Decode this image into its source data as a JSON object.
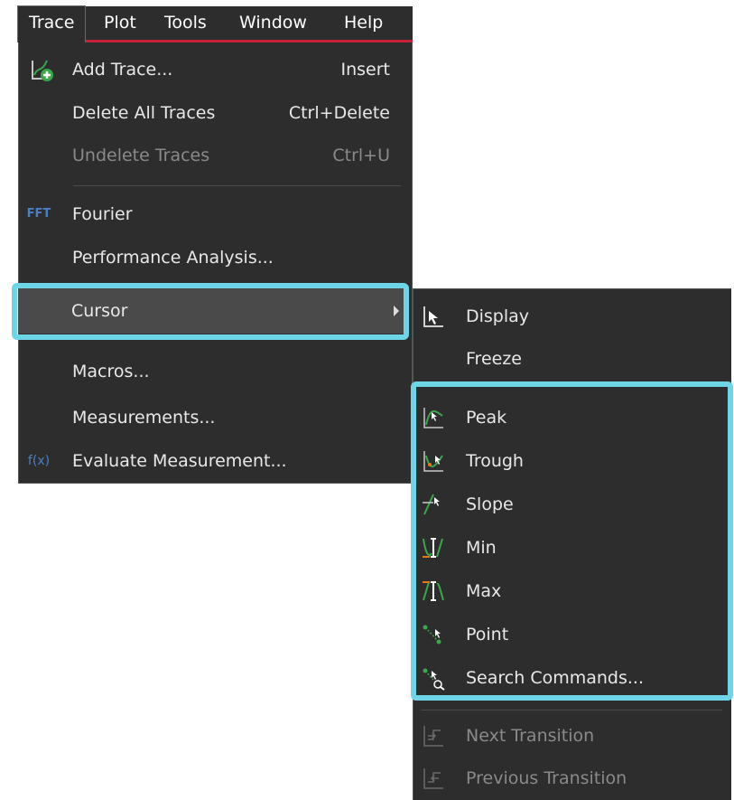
{
  "menubar": {
    "items": [
      "Trace",
      "Plot",
      "Tools",
      "Window",
      "Help"
    ]
  },
  "trace_menu": {
    "items": [
      {
        "label": "Add Trace...",
        "shortcut": "Insert",
        "icon": "add-trace-icon"
      },
      {
        "label": "Delete All Traces",
        "shortcut": "Ctrl+Delete"
      },
      {
        "label": "Undelete Traces",
        "shortcut": "Ctrl+U",
        "disabled": true
      },
      {
        "label": "Fourier",
        "icon_text": "FFT"
      },
      {
        "label": "Performance Analysis..."
      },
      {
        "label": "Cursor",
        "has_submenu": true,
        "highlighted": true
      },
      {
        "label": "Macros..."
      },
      {
        "label": "Measurements..."
      },
      {
        "label": "Evaluate Measurement...",
        "icon_text": "f(x)"
      }
    ]
  },
  "cursor_submenu": {
    "items": [
      {
        "label": "Display",
        "icon": "cursor-display-icon"
      },
      {
        "label": "Freeze"
      },
      {
        "label": "Peak",
        "icon": "peak-icon"
      },
      {
        "label": "Trough",
        "icon": "trough-icon"
      },
      {
        "label": "Slope",
        "icon": "slope-icon"
      },
      {
        "label": "Min",
        "icon": "min-icon"
      },
      {
        "label": "Max",
        "icon": "max-icon"
      },
      {
        "label": "Point",
        "icon": "point-icon"
      },
      {
        "label": "Search Commands...",
        "icon": "search-commands-icon"
      },
      {
        "label": "Next Transition",
        "icon": "next-transition-icon",
        "disabled": true
      },
      {
        "label": "Previous Transition",
        "icon": "previous-transition-icon",
        "disabled": true
      }
    ]
  },
  "colors": {
    "menu_bg": "#2d2d2d",
    "accent_red": "#c8213a",
    "highlight_cyan": "#6dd5e6",
    "icon_blue": "#4a7fc8"
  }
}
